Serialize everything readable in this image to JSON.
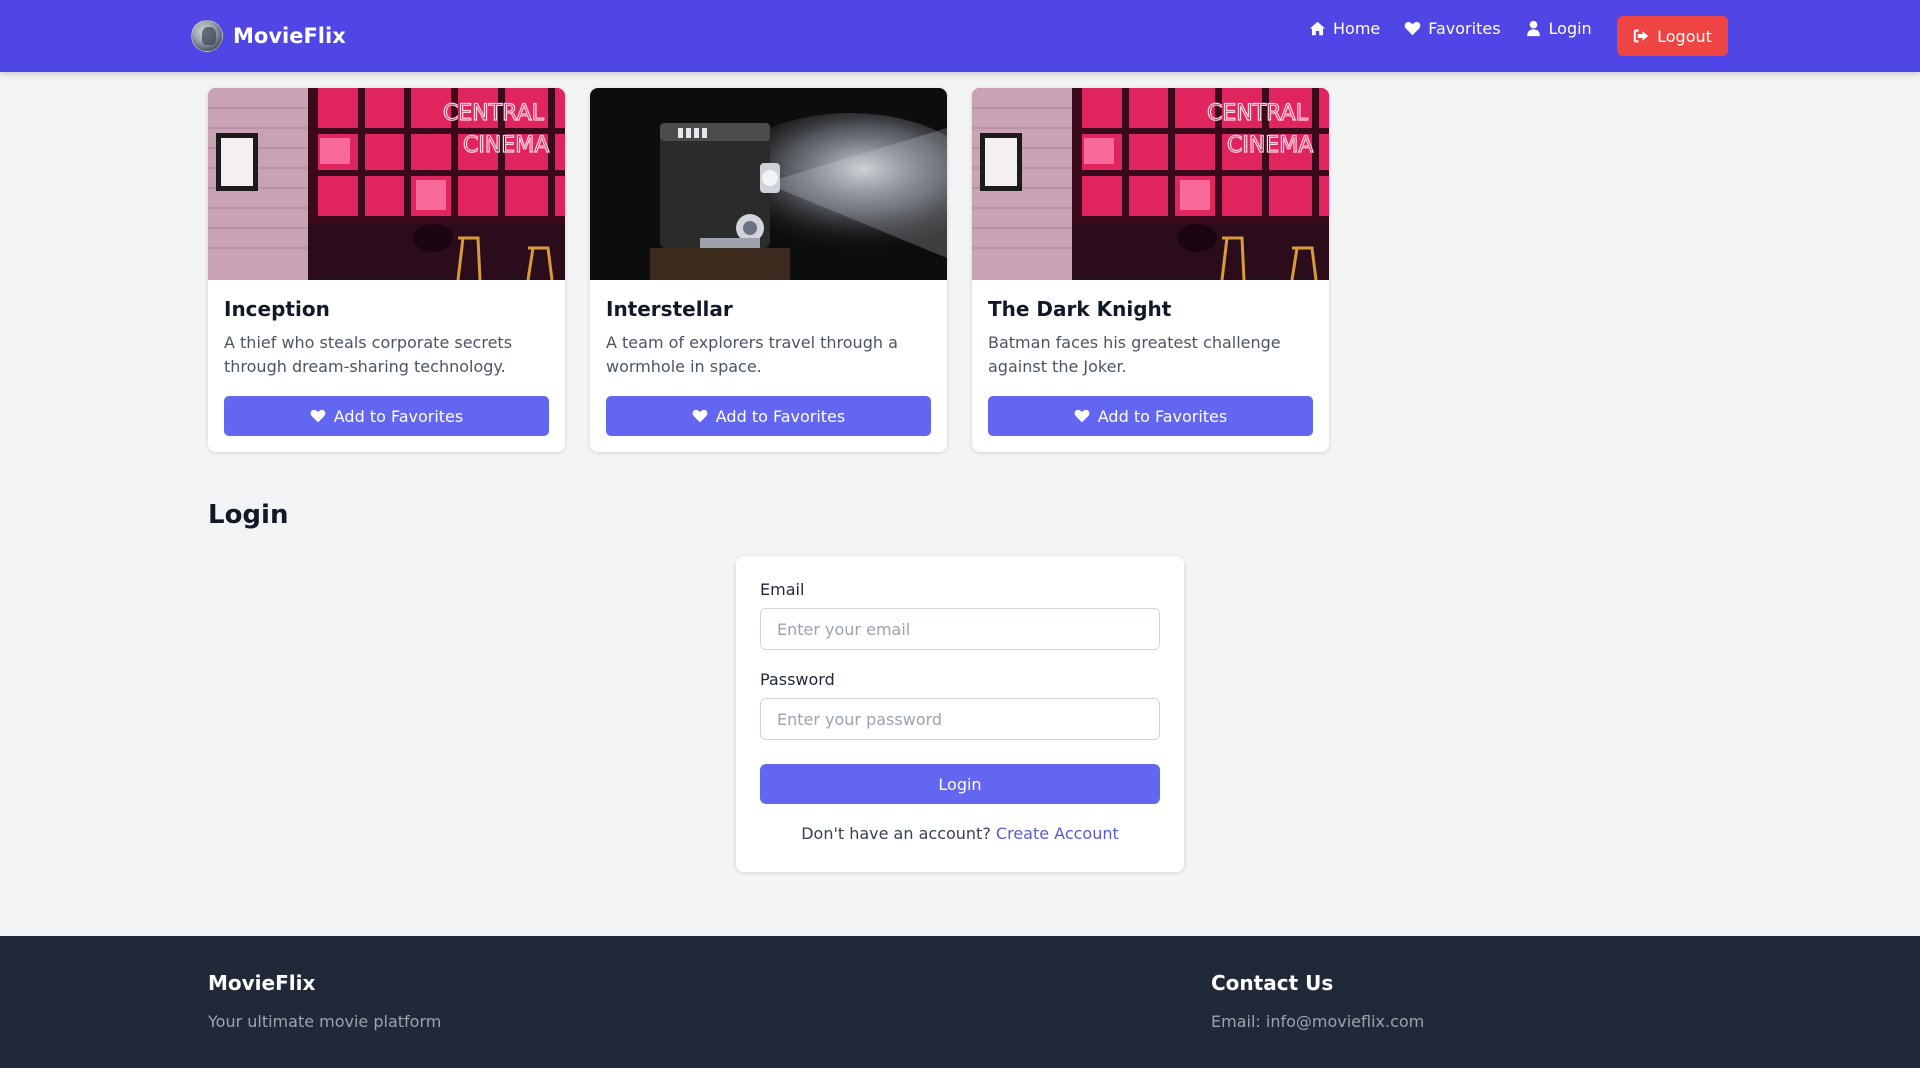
{
  "brand": {
    "name": "MovieFlix"
  },
  "nav": {
    "links": [
      {
        "label": "Home",
        "icon": "home-icon"
      },
      {
        "label": "Favorites",
        "icon": "heart-icon"
      },
      {
        "label": "Login",
        "icon": "user-icon"
      }
    ],
    "logout_label": "Logout"
  },
  "movies": [
    {
      "title": "Inception",
      "description": "A thief who steals corporate secrets through dream-sharing technology.",
      "button_label": "Add to Favorites",
      "poster": "neon-cinema-storefront",
      "neon_text": [
        "CENTRAL",
        "CINEMA"
      ]
    },
    {
      "title": "Interstellar",
      "description": "A team of explorers travel through a wormhole in space.",
      "button_label": "Add to Favorites",
      "poster": "film-projector"
    },
    {
      "title": "The Dark Knight",
      "description": "Batman faces his greatest challenge against the Joker.",
      "button_label": "Add to Favorites",
      "poster": "neon-cinema-storefront",
      "neon_text": [
        "CENTRAL",
        "CINEMA"
      ]
    }
  ],
  "login": {
    "heading": "Login",
    "email_label": "Email",
    "email_placeholder": "Enter your email",
    "email_value": "",
    "password_label": "Password",
    "password_placeholder": "Enter your password",
    "password_value": "",
    "submit_label": "Login",
    "signup_prompt": "Don't have an account?",
    "signup_link": "Create Account"
  },
  "footer": {
    "brand_title": "MovieFlix",
    "tagline": "Your ultimate movie platform",
    "contact_title": "Contact Us",
    "contact_email": "Email: info@movieflix.com"
  },
  "colors": {
    "navbar": "#4f46e5",
    "accent": "#6366f1",
    "logout": "#ef4444",
    "footer": "#1f2937",
    "link": "#5b5bd6"
  }
}
